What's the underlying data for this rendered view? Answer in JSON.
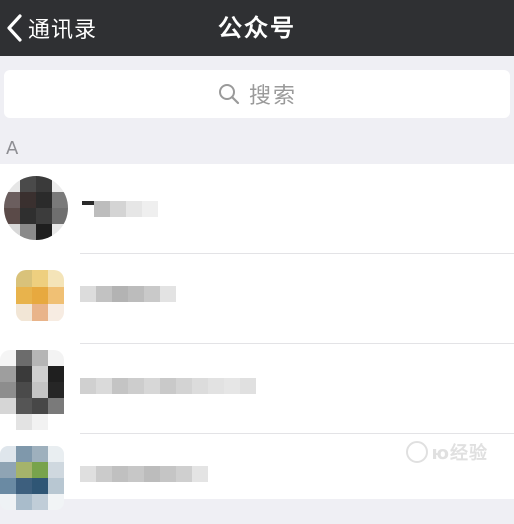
{
  "nav": {
    "back_label": "通讯录",
    "title": "公众号"
  },
  "search": {
    "placeholder": "搜索"
  },
  "section": {
    "letter": "A"
  },
  "accounts": [
    {
      "name_blurred": true
    },
    {
      "name_blurred": true
    },
    {
      "name_blurred": true
    },
    {
      "name_blurred": true
    }
  ],
  "watermark": {
    "text": "ю经验"
  },
  "colors": {
    "navbar": "#2f3033",
    "background": "#efeff4",
    "list_background": "#ffffff"
  },
  "icons": {
    "back": "chevron-left-icon",
    "search": "search-icon"
  }
}
